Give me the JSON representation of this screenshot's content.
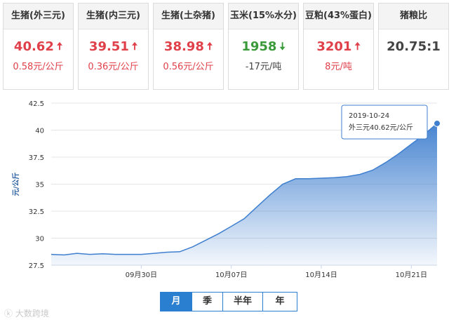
{
  "cards": [
    {
      "title": "生猪(外三元)",
      "price": "40.62",
      "direction": "up",
      "change": "0.58元/公斤"
    },
    {
      "title": "生猪(内三元)",
      "price": "39.51",
      "direction": "up",
      "change": "0.36元/公斤"
    },
    {
      "title": "生猪(土杂猪)",
      "price": "38.98",
      "direction": "up",
      "change": "0.56元/公斤"
    },
    {
      "title": "玉米(15%水分)",
      "price": "1958",
      "direction": "down",
      "change": "-17元/吨"
    },
    {
      "title": "豆粕(43%蛋白)",
      "price": "3201",
      "direction": "up",
      "change": "8元/吨"
    },
    {
      "title": "猪粮比",
      "price": "20.75:1",
      "direction": "none",
      "change": ""
    }
  ],
  "chart_data": {
    "type": "area",
    "ylabel": "元/公斤",
    "ylim": [
      27.5,
      42.5
    ],
    "yticks": [
      "27.5",
      "30",
      "32.5",
      "35",
      "37.5",
      "40",
      "42.5"
    ],
    "x_ticks": [
      {
        "index": 7,
        "label": "09月30日"
      },
      {
        "index": 14,
        "label": "10月07日"
      },
      {
        "index": 21,
        "label": "10月14日"
      },
      {
        "index": 28,
        "label": "10月21日"
      }
    ],
    "series": [
      {
        "values": [
          28.5,
          28.45,
          28.6,
          28.5,
          28.55,
          28.5,
          28.5,
          28.5,
          28.6,
          28.7,
          28.75,
          29.2,
          29.8,
          30.4,
          31.1,
          31.8,
          32.9,
          34.0,
          35.0,
          35.5,
          35.5,
          35.55,
          35.6,
          35.7,
          35.9,
          36.3,
          37.0,
          37.8,
          38.7,
          39.6,
          40.62
        ]
      }
    ],
    "tooltip": {
      "date": "2019-10-24",
      "text": "外三元40.62元/公斤"
    }
  },
  "colors": {
    "up": "#e0404a",
    "down": "#3a9a3a",
    "line": "#3f7fcf",
    "accent": "#2a7fd0"
  },
  "tabs": [
    {
      "label": "月",
      "active": true
    },
    {
      "label": "季",
      "active": false
    },
    {
      "label": "半年",
      "active": false
    },
    {
      "label": "年",
      "active": false
    }
  ],
  "watermark": "大数跨境"
}
